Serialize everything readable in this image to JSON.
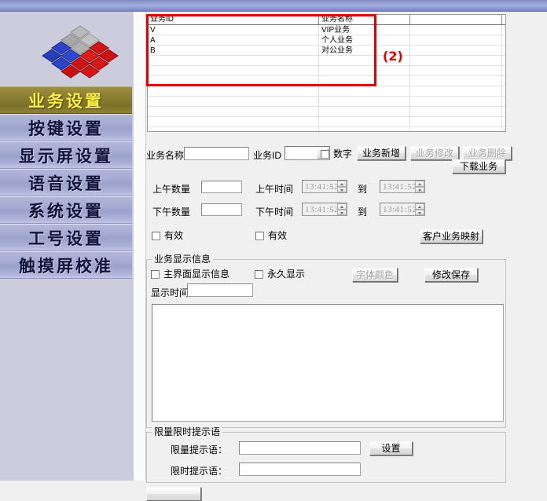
{
  "app": {
    "title": "业务设置",
    "accent": "#8d8033",
    "annotation_color": "#e20000"
  },
  "sidebar": {
    "logo_name": "cube-diamond-logo",
    "items": [
      {
        "label": "业务设置",
        "active": true
      },
      {
        "label": "按键设置",
        "active": false
      },
      {
        "label": "显示屏设置",
        "active": false
      },
      {
        "label": "语音设置",
        "active": false
      },
      {
        "label": "系统设置",
        "active": false
      },
      {
        "label": "工号设置",
        "active": false
      },
      {
        "label": "触摸屏校准",
        "active": false
      }
    ]
  },
  "annotation": {
    "label": "(2)"
  },
  "grid": {
    "columns": [
      "业务ID",
      "业务名称",
      ""
    ],
    "rows": [
      [
        "V",
        "VIP业务",
        ""
      ],
      [
        "A",
        "个人业务",
        ""
      ],
      [
        "B",
        "对公业务",
        ""
      ]
    ],
    "empty_row_count": 8
  },
  "form": {
    "name_label": "业务名称",
    "name_value": "",
    "id_label": "业务ID",
    "id_value": "",
    "number_checkbox": {
      "label": "数字",
      "checked": false
    },
    "add_button": {
      "label": "业务新增",
      "enabled": true
    },
    "edit_button": {
      "label": "业务修改",
      "enabled": false
    },
    "delete_button": {
      "label": "业务删除",
      "enabled": false
    },
    "download_button": {
      "label": "下载业务",
      "enabled": true
    }
  },
  "schedule": {
    "am_count_label": "上午数量",
    "am_count_value": "",
    "am_time_label": "上午时间",
    "am_time_from": "13:41:52",
    "am_time_to": "13:41:52",
    "pm_count_label": "下午数量",
    "pm_count_value": "",
    "pm_time_label": "下午时间",
    "pm_time_from": "13:41:52",
    "pm_time_to": "13:41:52",
    "to_label": "到",
    "am_valid": {
      "label": "有效",
      "checked": false
    },
    "pm_valid": {
      "label": "有效",
      "checked": false
    },
    "mapping_button": {
      "label": "客户业务映射",
      "enabled": true
    }
  },
  "display_group": {
    "title": "业务显示信息",
    "main_screen_checkbox": {
      "label": "主界面显示信息",
      "checked": false
    },
    "permanent_checkbox": {
      "label": "永久显示",
      "checked": false
    },
    "font_color_button": {
      "label": "字体颜色",
      "enabled": false
    },
    "save_button": {
      "label": "修改保存",
      "enabled": true
    },
    "time_label": "显示时间",
    "time_value": "",
    "content_value": ""
  },
  "limit_group": {
    "title": "限量限时提示语",
    "quantity_label": "限量提示语：",
    "quantity_value": "",
    "time_label": "限时提示语：",
    "time_value": "",
    "set_button": {
      "label": "设置",
      "enabled": true
    }
  },
  "footer": {
    "partial_button_label": ""
  }
}
